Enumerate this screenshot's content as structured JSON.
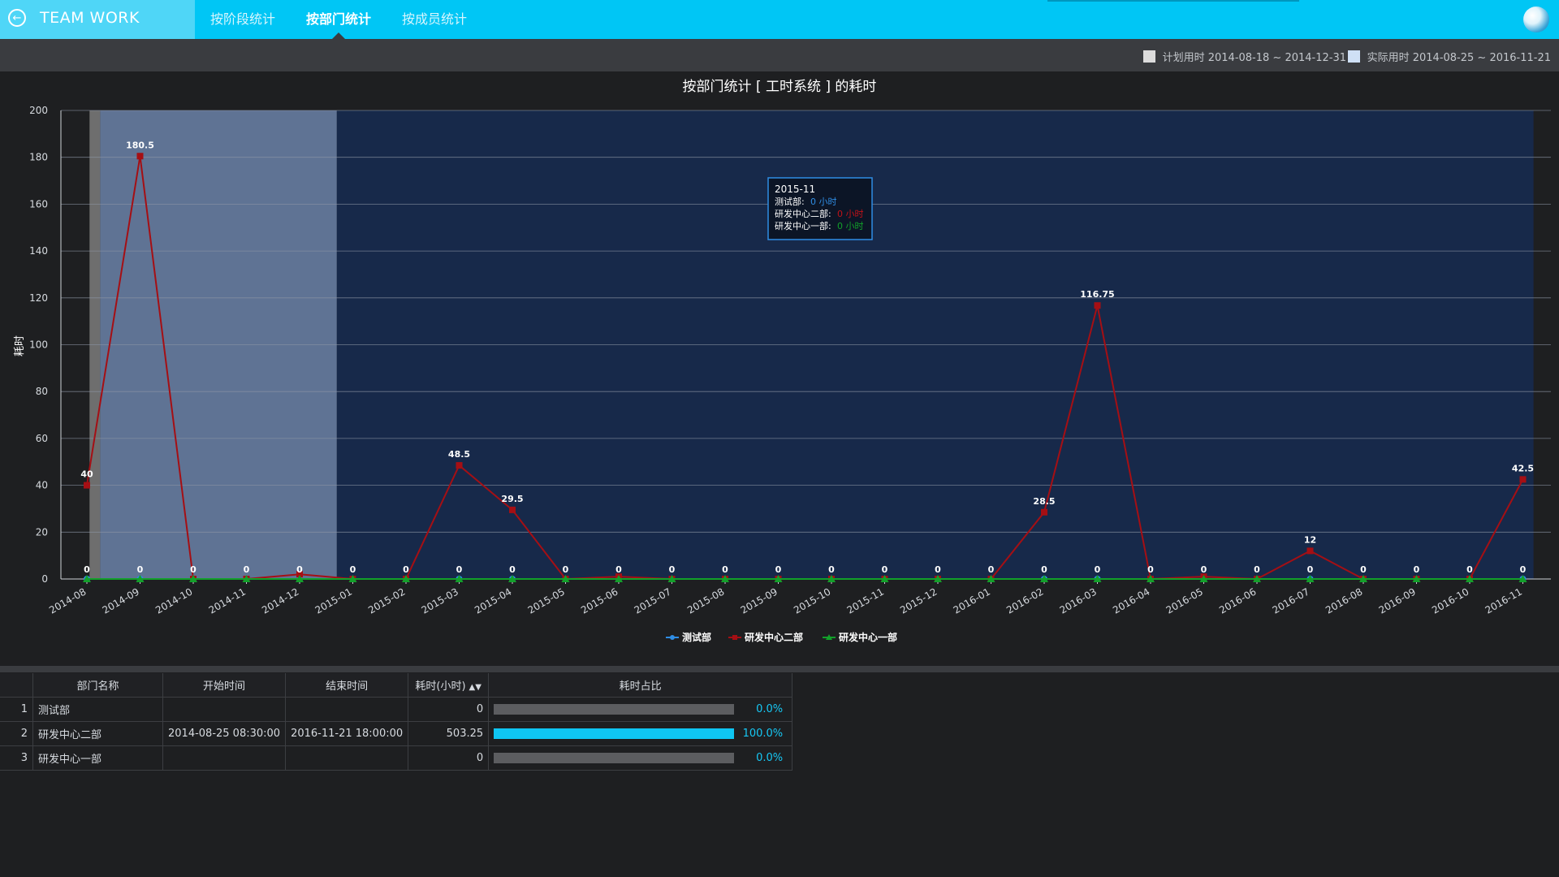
{
  "header": {
    "brand": "TEAM WORK",
    "tabs": [
      {
        "label": "按阶段统计",
        "active": false
      },
      {
        "label": "按部门统计",
        "active": true
      },
      {
        "label": "按成员统计",
        "active": false
      }
    ]
  },
  "legend": {
    "plan_label": "计划用时 2014-08-18 ~ 2014-12-31",
    "actual_label": "实际用时 2014-08-25 ~ 2016-11-21",
    "plan_color": "#dcdcdc",
    "actual_color": "#cfe0f5"
  },
  "chart_data": {
    "type": "line",
    "title": "按部门统计 [ 工时系统 ] 的耗时",
    "ylabel": "耗时",
    "xlabel": "",
    "ylim": [
      0,
      200
    ],
    "yticks": [
      0,
      20,
      40,
      60,
      80,
      100,
      120,
      140,
      160,
      180,
      200
    ],
    "grid": true,
    "legend_position": "bottom",
    "categories": [
      "2014-08",
      "2014-09",
      "2014-10",
      "2014-11",
      "2014-12",
      "2015-01",
      "2015-02",
      "2015-03",
      "2015-04",
      "2015-05",
      "2015-06",
      "2015-07",
      "2015-08",
      "2015-09",
      "2015-10",
      "2015-11",
      "2015-12",
      "2016-01",
      "2016-02",
      "2016-03",
      "2016-04",
      "2016-05",
      "2016-06",
      "2016-07",
      "2016-08",
      "2016-09",
      "2016-10",
      "2016-11"
    ],
    "series": [
      {
        "name": "测试部",
        "color": "#2f8de4",
        "marker": "circle",
        "values": [
          0,
          0,
          0,
          0,
          0,
          0,
          0,
          0,
          0,
          0,
          0,
          0,
          0,
          0,
          0,
          0,
          0,
          0,
          0,
          0,
          0,
          0,
          0,
          0,
          0,
          0,
          0,
          0
        ]
      },
      {
        "name": "研发中心二部",
        "color": "#a50f14",
        "marker": "square",
        "values": [
          40,
          180.5,
          0,
          0,
          2,
          0,
          0,
          48.5,
          29.5,
          0,
          1,
          0,
          0,
          0,
          0,
          0,
          0,
          0,
          28.5,
          116.75,
          0,
          1,
          0,
          12,
          0,
          0,
          0,
          42.5
        ]
      },
      {
        "name": "研发中心一部",
        "color": "#12a02a",
        "marker": "triangle",
        "values": [
          0,
          0,
          0,
          0,
          0,
          0,
          0,
          0,
          0,
          0,
          0,
          0,
          0,
          0,
          0,
          0,
          0,
          0,
          0,
          0,
          0,
          0,
          0,
          0,
          0,
          0,
          0,
          0
        ]
      }
    ],
    "labels_series2": [
      "40",
      "180.5",
      "0",
      "0",
      "",
      "0",
      "0",
      "48.5",
      "29.5",
      "0",
      "0",
      "0",
      "0",
      "0",
      "0",
      "0",
      "0",
      "0",
      "28.5",
      "116.75",
      "0",
      "0",
      "0",
      "12",
      "0",
      "0",
      "0",
      "42.5"
    ],
    "labels_zero": [
      "0",
      "0",
      "0",
      "0",
      "0",
      "0",
      "0",
      "0",
      "0",
      "0",
      "0",
      "0",
      "0",
      "0",
      "0",
      "0",
      "0",
      "0",
      "0",
      "0",
      "0",
      "0",
      "0",
      "0",
      "0",
      "0",
      "0",
      "0"
    ],
    "bands": [
      {
        "from": 0.05,
        "to": 0.25,
        "color": "#6e6e6e"
      },
      {
        "from": 0.25,
        "to": 4.7,
        "color": "#5f7394"
      },
      {
        "from": 4.7,
        "to": 27.2,
        "color": "#17294a"
      }
    ],
    "tooltip": {
      "title": "2015-11",
      "rows": [
        {
          "label": "测试部:",
          "value": "0 小时",
          "color": "#2f8de4"
        },
        {
          "label": "研发中心二部:",
          "value": "0 小时",
          "color": "#c01218"
        },
        {
          "label": "研发中心一部:",
          "value": "0 小时",
          "color": "#12a02a"
        }
      ]
    }
  },
  "table": {
    "headers": [
      "部门名称",
      "开始时间",
      "结束时间",
      "耗时(小时)",
      "耗时占比"
    ],
    "rows": [
      {
        "index": "1",
        "name": "测试部",
        "start": "",
        "end": "",
        "hours": "0",
        "ratio": 0.0,
        "ratio_label": "0.0%"
      },
      {
        "index": "2",
        "name": "研发中心二部",
        "start": "2014-08-25 08:30:00",
        "end": "2016-11-21 18:00:00",
        "hours": "503.25",
        "ratio": 1.0,
        "ratio_label": "100.0%"
      },
      {
        "index": "3",
        "name": "研发中心一部",
        "start": "",
        "end": "",
        "hours": "0",
        "ratio": 0.0,
        "ratio_label": "0.0%"
      }
    ]
  }
}
